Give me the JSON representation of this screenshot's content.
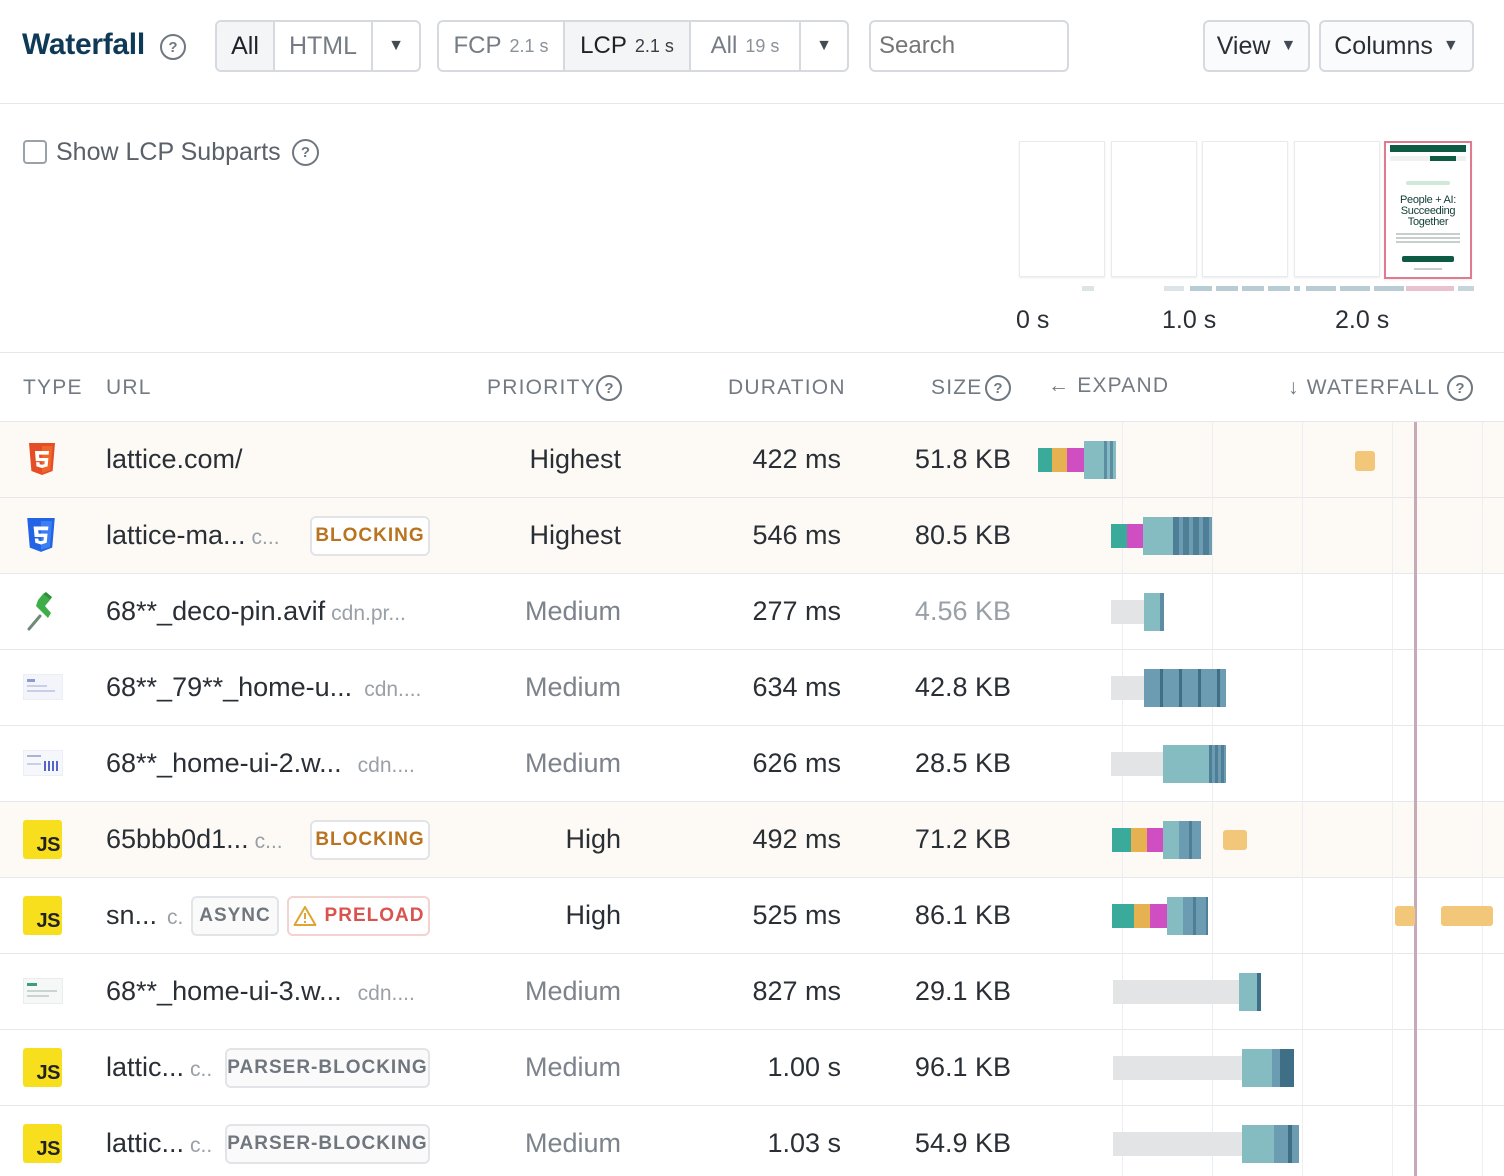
{
  "header": {
    "title": "Waterfall",
    "type_filter": {
      "options": [
        "All",
        "HTML"
      ],
      "active": "All"
    },
    "milestones": [
      {
        "label": "FCP",
        "value": "2.1 s",
        "active": false
      },
      {
        "label": "LCP",
        "value": "2.1 s",
        "active": true
      },
      {
        "label": "All",
        "value": "19 s",
        "active": false
      }
    ],
    "search_placeholder": "Search",
    "view_label": "View",
    "columns_label": "Columns"
  },
  "options": {
    "show_lcp_subparts": "Show LCP Subparts",
    "show_lcp_subparts_checked": false
  },
  "timeline": {
    "ticks": [
      "0 s",
      "1.0 s",
      "2.0 s"
    ]
  },
  "filmstrip_lcp_frame": {
    "headline": "People + AI: Succeeding Together"
  },
  "table": {
    "columns": {
      "type": "TYPE",
      "url": "URL",
      "priority": "PRIORITY",
      "duration": "DURATION",
      "size": "SIZE",
      "expand": "EXPAND",
      "waterfall": "WATERFALL"
    },
    "rows": [
      {
        "type": "html",
        "icon": "html5-icon",
        "url": "lattice.com/",
        "domain": "",
        "badges": [],
        "priority": "Highest",
        "duration": "422 ms",
        "size": "51.8 KB",
        "highlight": true
      },
      {
        "type": "css",
        "icon": "css3-icon",
        "url": "lattice-ma...",
        "domain": "c...",
        "badges": [
          "BLOCKING"
        ],
        "priority": "Highest",
        "duration": "546 ms",
        "size": "80.5 KB",
        "highlight": true
      },
      {
        "type": "image",
        "icon": "pushpin-icon",
        "url": "68**_deco-pin.avif",
        "domain": "cdn.pr...",
        "badges": [],
        "priority": "Medium",
        "duration": "277 ms",
        "size": "4.56 KB",
        "highlight": false
      },
      {
        "type": "image",
        "icon": "image-thumbnail-icon",
        "url": "68**_79**_home-u...",
        "domain": "cdn....",
        "badges": [],
        "priority": "Medium",
        "duration": "634 ms",
        "size": "42.8 KB",
        "highlight": false
      },
      {
        "type": "image",
        "icon": "image-thumbnail-icon",
        "url": "68**_home-ui-2.w...",
        "domain": "cdn....",
        "badges": [],
        "priority": "Medium",
        "duration": "626 ms",
        "size": "28.5 KB",
        "highlight": false
      },
      {
        "type": "js",
        "icon": "javascript-icon",
        "url": "65bbb0d1...",
        "domain": "c...",
        "badges": [
          "BLOCKING"
        ],
        "priority": "High",
        "duration": "492 ms",
        "size": "71.2 KB",
        "highlight": true
      },
      {
        "type": "js",
        "icon": "javascript-icon",
        "url": "sn...",
        "domain": "c.",
        "badges": [
          "ASYNC",
          "PRELOAD"
        ],
        "priority": "High",
        "duration": "525 ms",
        "size": "86.1 KB",
        "highlight": false
      },
      {
        "type": "image",
        "icon": "image-thumbnail-icon",
        "url": "68**_home-ui-3.w...",
        "domain": "cdn....",
        "badges": [],
        "priority": "Medium",
        "duration": "827 ms",
        "size": "29.1 KB",
        "highlight": false
      },
      {
        "type": "js",
        "icon": "javascript-icon",
        "url": "lattic...",
        "domain": "c..",
        "badges": [
          "PARSER-BLOCKING"
        ],
        "priority": "Medium",
        "duration": "1.00 s",
        "size": "96.1 KB",
        "highlight": false
      },
      {
        "type": "js",
        "icon": "javascript-icon",
        "url": "lattic...",
        "domain": "c..",
        "badges": [
          "PARSER-BLOCKING"
        ],
        "priority": "Medium",
        "duration": "1.03 s",
        "size": "54.9 KB",
        "highlight": false
      }
    ]
  },
  "colors": {
    "dns": "#3aaa9b",
    "connect": "#e6b150",
    "ssl": "#cf4fc3",
    "ttfb": "#85bcc1",
    "download": "#5d8da3",
    "queue": "#e2e4e6",
    "main_thread": "#f2c77a",
    "lcp_marker": "#c8a9b7"
  }
}
